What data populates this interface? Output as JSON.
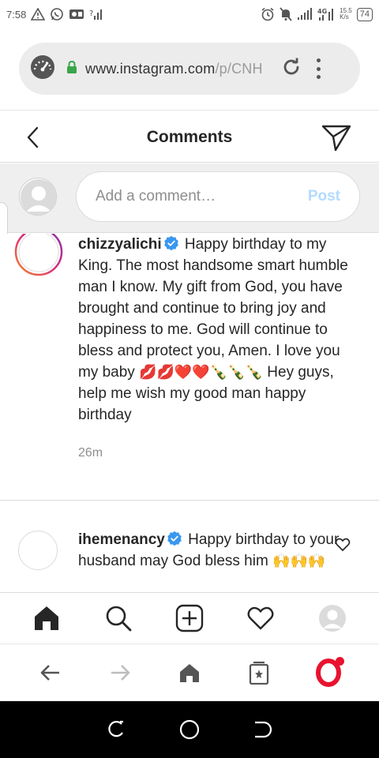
{
  "status_bar": {
    "time": "7:58",
    "battery": "74",
    "speed_top": "15.5",
    "speed_bottom": "K/s",
    "network": "4G"
  },
  "browser": {
    "url_main": "www.instagram.com",
    "url_faded": "/p/CNH",
    "icons": [
      "speed-dial-icon",
      "lock-icon",
      "reload-icon",
      "more-icon"
    ]
  },
  "header": {
    "title": "Comments"
  },
  "add_comment": {
    "placeholder": "Add a comment…",
    "post_label": "Post"
  },
  "comments": [
    {
      "username": "chizzyalichi",
      "verified": true,
      "text_1": "Happy birthday to my King. The most handsome smart humble man I know. My gift from God, you have brought and continue to bring joy and happiness to me. God will continue to bless and protect you, Amen. I love you my baby",
      "emoji_lips": "💋💋",
      "emoji_hearts": "❤️❤️",
      "emoji_bottles": "🍾🍾🍾",
      "text_2": "Hey guys, help me wish my good man happy birthday",
      "time": "26m"
    },
    {
      "username": "ihemenancy",
      "verified": true,
      "text_1": "Happy birthday to your husband may God bless him",
      "emoji_hands": "🙌🙌🙌"
    }
  ],
  "ig_nav": [
    "home-icon",
    "search-icon",
    "new-post-icon",
    "activity-icon",
    "profile-icon"
  ],
  "browser_nav": [
    "back-icon",
    "forward-icon",
    "home-icon",
    "tabs-icon",
    "opera-icon"
  ],
  "colors": {
    "post_disabled": "#b3dbff",
    "verified_blue": "#3897f0",
    "ring_orange": "#f58529",
    "ring_pink": "#dd2a7b",
    "opera_red": "#e8132f"
  }
}
